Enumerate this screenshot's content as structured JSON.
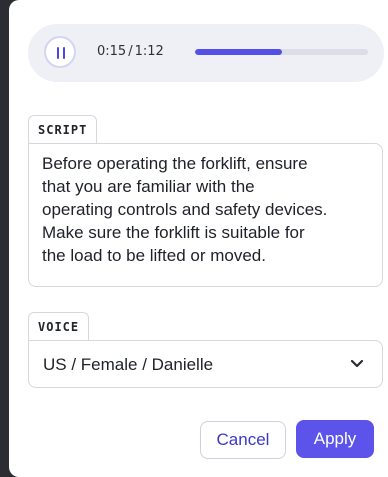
{
  "player": {
    "current_time": "0:15",
    "separator": "/",
    "total_time": "1:12",
    "progress_fraction": 0.5
  },
  "script": {
    "label": "SCRIPT",
    "text": "Before operating the forklift, ensure\nthat you are familiar with the\noperating controls and safety devices.\nMake sure the forklift is suitable for\nthe load to be lifted or moved."
  },
  "voice": {
    "label": "VOICE",
    "selected": "US / Female / Danielle"
  },
  "actions": {
    "cancel_label": "Cancel",
    "apply_label": "Apply"
  },
  "colors": {
    "accent": "#5b53ea",
    "progress_fill": "#5450e6"
  },
  "icons": {
    "pause": "pause-icon",
    "dropdown": "chevron-down-icon"
  }
}
